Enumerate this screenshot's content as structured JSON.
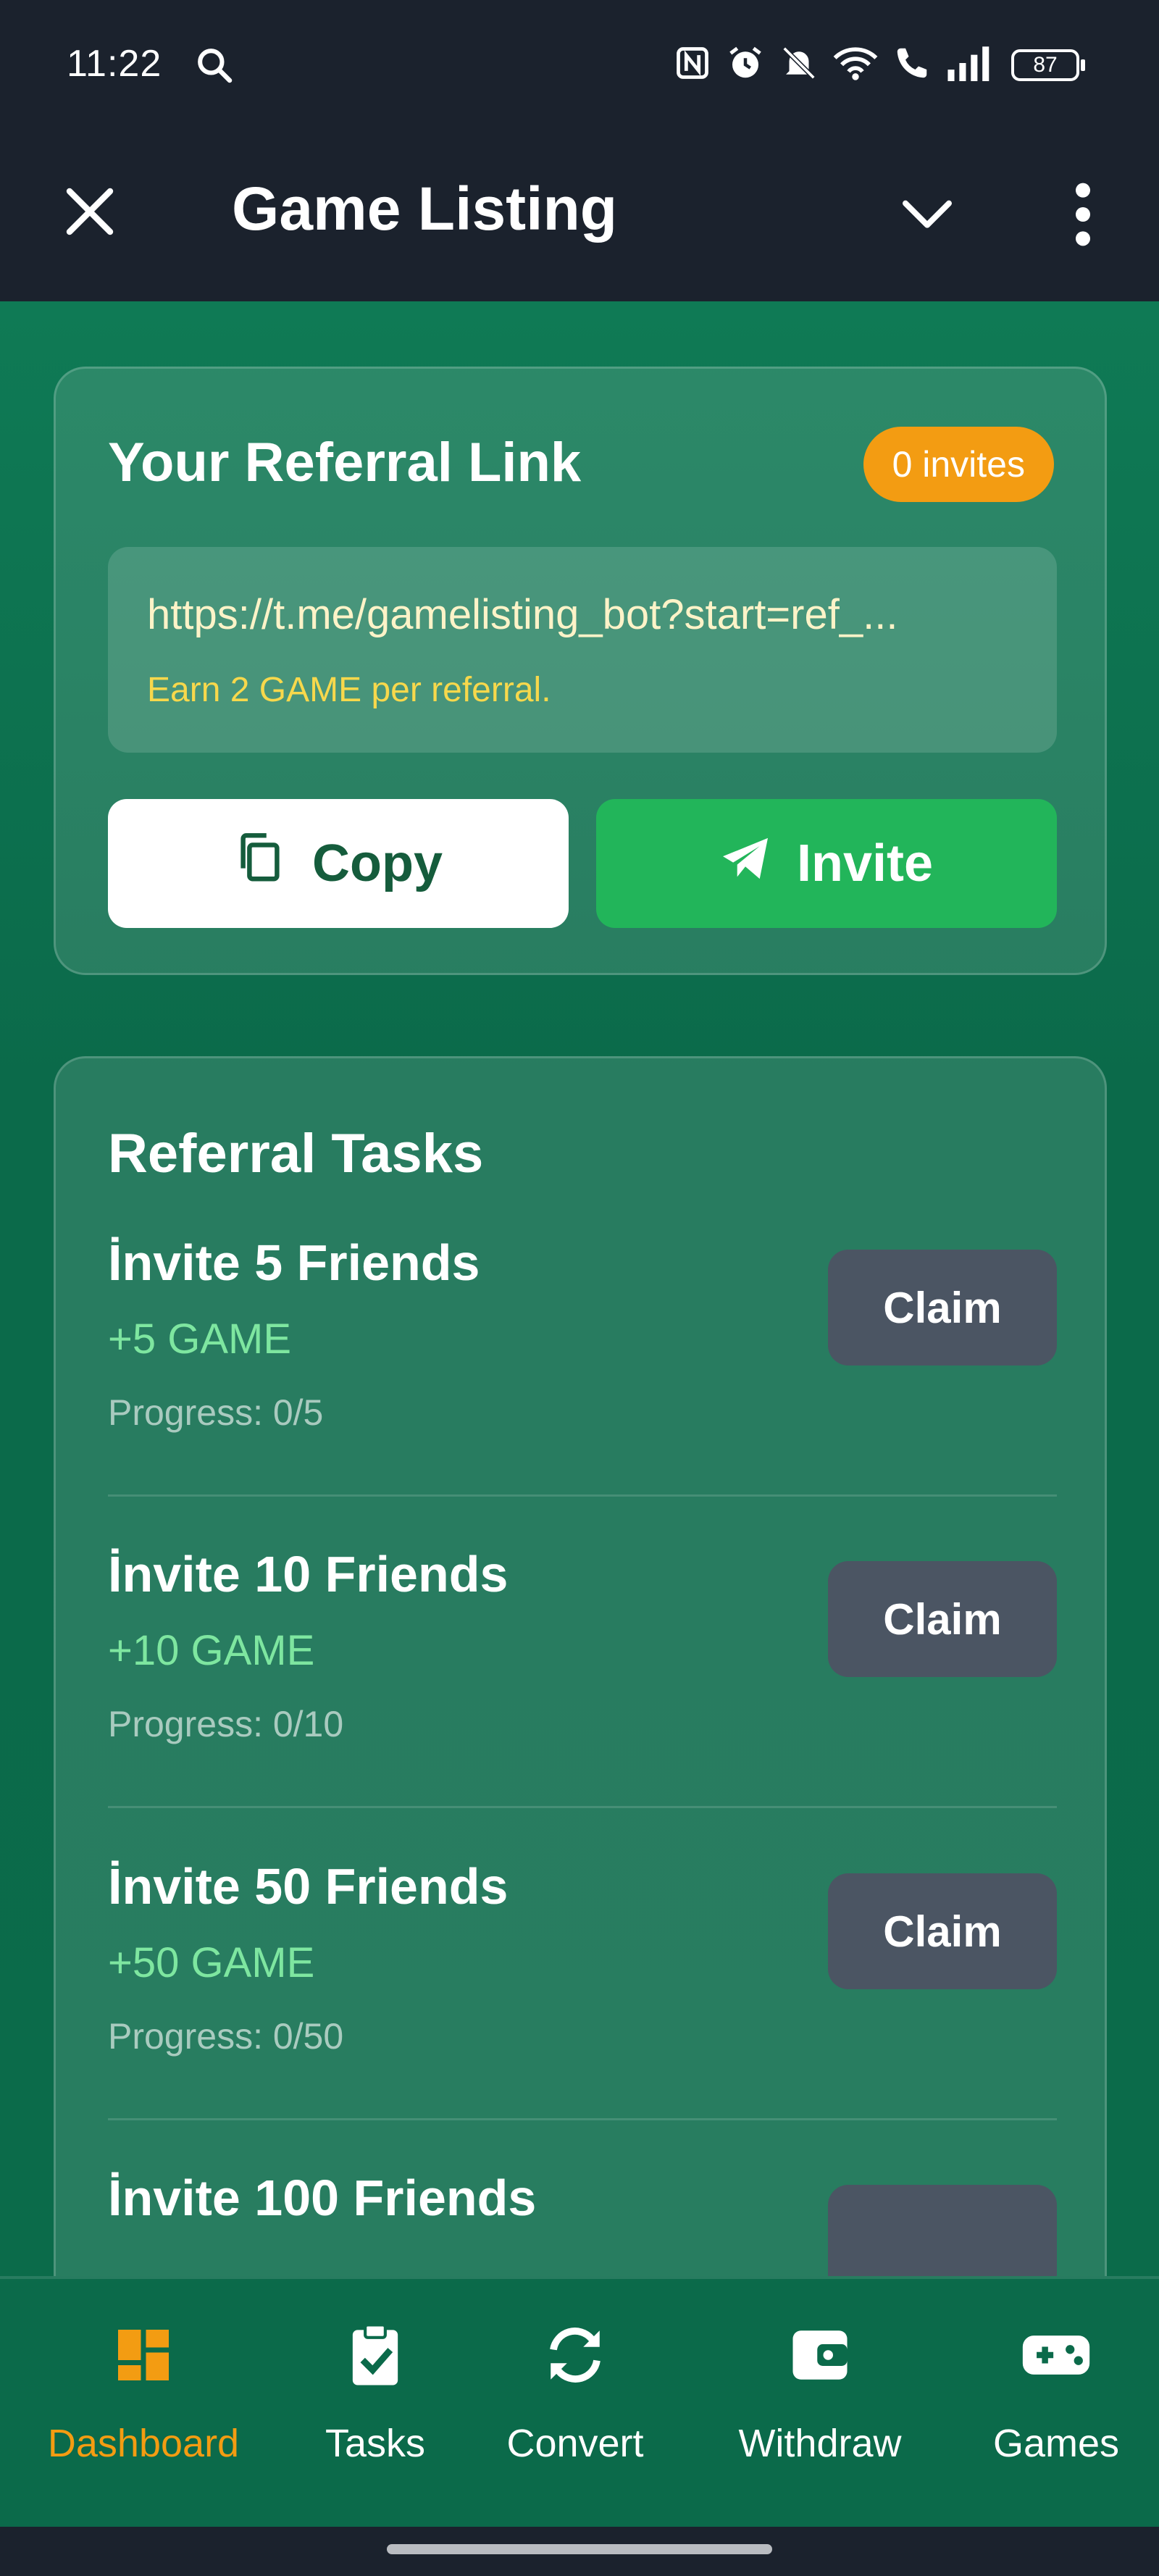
{
  "status_bar": {
    "time": "11:22",
    "battery": "87"
  },
  "header": {
    "title": "Game Listing"
  },
  "referral": {
    "title": "Your Referral Link",
    "invites_badge": "0 invites",
    "link": "https://t.me/gamelisting_bot?start=ref_...",
    "earn_note": "Earn 2 GAME per referral.",
    "copy_label": "Copy",
    "invite_label": "Invite"
  },
  "tasks": {
    "title": "Referral Tasks",
    "items": [
      {
        "name": "İnvite 5 Friends",
        "reward": "+5 GAME",
        "progress": "Progress: 0/5",
        "button": "Claim"
      },
      {
        "name": "İnvite 10 Friends",
        "reward": "+10 GAME",
        "progress": "Progress: 0/10",
        "button": "Claim"
      },
      {
        "name": "İnvite 50 Friends",
        "reward": "+50 GAME",
        "progress": "Progress: 0/50",
        "button": "Claim"
      },
      {
        "name": "İnvite 100 Friends",
        "reward": "",
        "progress": "",
        "button": ""
      }
    ]
  },
  "bottom_nav": {
    "items": [
      {
        "label": "Dashboard",
        "icon": "dashboard-icon",
        "active": true
      },
      {
        "label": "Tasks",
        "icon": "clipboard-check-icon",
        "active": false
      },
      {
        "label": "Convert",
        "icon": "sync-icon",
        "active": false
      },
      {
        "label": "Withdraw",
        "icon": "wallet-icon",
        "active": false
      },
      {
        "label": "Games",
        "icon": "gamepad-icon",
        "active": false
      }
    ]
  },
  "colors": {
    "accent": "#f39c12",
    "primary_green": "#22b55a",
    "background_green": "#0b6a4a",
    "header_dark": "#1b222d"
  }
}
